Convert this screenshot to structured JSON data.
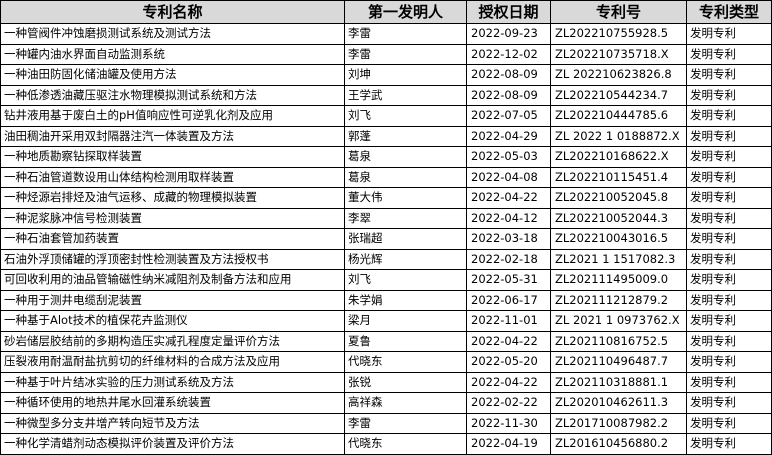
{
  "table": {
    "headers": [
      "专利名称",
      "第一发明人",
      "授权日期",
      "专利号",
      "专利类型"
    ],
    "rows": [
      [
        "一种管阀件冲蚀磨损测试系统及测试方法",
        "李雷",
        "2022-09-23",
        "ZL202210755928.5",
        "发明专利"
      ],
      [
        "一种罐内油水界面自动监测系统",
        "李雷",
        "2022-12-02",
        "ZL202210735718.X",
        "发明专利"
      ],
      [
        "一种油田防固化储油罐及使用方法",
        "刘坤",
        "2022-08-09",
        "ZL 202210623826.8",
        "发明专利"
      ],
      [
        "一种低渗透油藏压驱注水物理模拟测试系统和方法",
        "王学武",
        "2022-08-09",
        "ZL202210544234.7",
        "发明专利"
      ],
      [
        "钻井液用基于废白土的pH值响应性可逆乳化剂及应用",
        "刘飞",
        "2022-07-05",
        "ZL202210444785.6",
        "发明专利"
      ],
      [
        "油田稠油开采用双封隔器注汽一体装置及方法",
        "郭蓬",
        "2022-04-29",
        "ZL 2022 1 0188872.X",
        "发明专利"
      ],
      [
        "一种地质勘察钻探取样装置",
        "葛泉",
        "2022-05-03",
        "ZL202210168622.X",
        "发明专利"
      ],
      [
        "一种石油管道数设用山体结构检测用取样装置",
        "葛泉",
        "2022-04-08",
        "ZL202210115451.4",
        "发明专利"
      ],
      [
        "一种烃源岩排烃及油气运移、成藏的物理模拟装置",
        "董大伟",
        "2022-04-22",
        "ZL202210052045.8",
        "发明专利"
      ],
      [
        "一种泥浆脉冲信号检测装置",
        "李翠",
        "2022-04-12",
        "ZL202210052044.3",
        "发明专利"
      ],
      [
        "一种石油套管加药装置",
        "张瑞超",
        "2022-03-18",
        "ZL202210043016.5",
        "发明专利"
      ],
      [
        "石油外浮顶储罐的浮顶密封性检测装置及方法授权书",
        "杨光辉",
        "2022-02-18",
        "ZL2021 1 1517082.3",
        "发明专利"
      ],
      [
        "可回收利用的油品管输磁性纳米减阻剂及制备方法和应用",
        "刘飞",
        "2022-05-31",
        "ZL202111495009.0",
        "发明专利"
      ],
      [
        "一种用于测井电缆刮泥装置",
        "朱学娟",
        "2022-06-17",
        "ZL202111212879.2",
        "发明专利"
      ],
      [
        "一种基于Alot技术的植保花卉监测仪",
        "梁月",
        "2022-11-01",
        "ZL  2021 1 0973762.X",
        "发明专利"
      ],
      [
        "砂岩储层胶结前的多期构造压实减孔程度定量评价方法",
        "夏鲁",
        "2022-04-22",
        "ZL202110816752.5",
        "发明专利"
      ],
      [
        "压裂液用耐温耐盐抗剪切的纤维材料的合成方法及应用",
        "代晓东",
        "2022-05-20",
        "ZL202110496487.7",
        "发明专利"
      ],
      [
        "一种基于叶片结冰实验的压力测试系统及方法",
        "张锐",
        "2022-04-22",
        "ZL202110318881.1",
        "发明专利"
      ],
      [
        "一种循环使用的地热井尾水回灌系统装置",
        "高祥森",
        "2022-02-22",
        "ZL202010462611.3",
        "发明专利"
      ],
      [
        "一种微型多分支井增产转向短节及方法",
        "李雷",
        "2022-11-30",
        "ZL201710087982.2",
        "发明专利"
      ],
      [
        "一种化学清蜡剂动态模拟评价装置及评价方法",
        "代晓东",
        "2022-04-19",
        "ZL201610456880.2",
        "发明专利"
      ]
    ]
  }
}
